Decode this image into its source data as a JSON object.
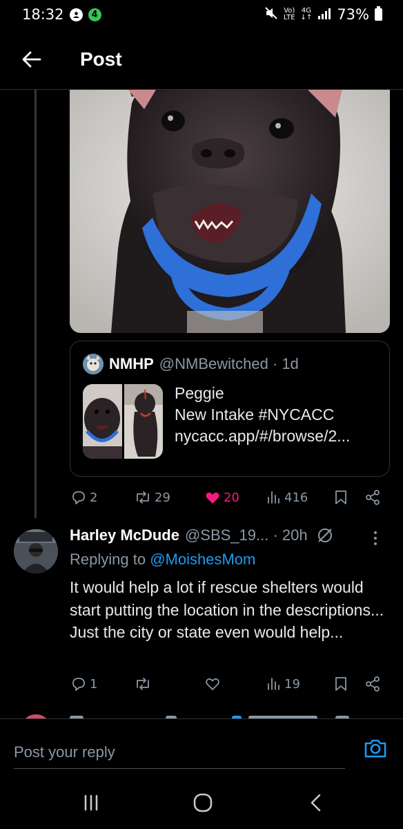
{
  "status_bar": {
    "time": "18:32",
    "notification_badge": "4",
    "network_top": "Vo)",
    "network_bottom": "LTE",
    "gen_top": "4G",
    "gen_bottom": "↓↑",
    "battery": "73%"
  },
  "header": {
    "title": "Post"
  },
  "quote": {
    "name": "NMHP",
    "handle_time": "@NMBewitched · 1d",
    "text_lines": [
      "Peggie",
      "New Intake #NYCACC",
      "nycacc.app/#/browse/2..."
    ]
  },
  "main_actions": {
    "replies": "2",
    "reposts": "29",
    "likes": "20",
    "views": "416"
  },
  "reply": {
    "name": "Harley McDude",
    "handle_time": "@SBS_19... · 20h",
    "replying_prefix": "Replying to ",
    "replying_to": "@MoishesMom",
    "text": "It would help a lot if rescue shelters would start putting the location in the descriptions... Just the city or state even would help...",
    "actions": {
      "replies": "1",
      "reposts": "",
      "likes": "",
      "views": "19"
    }
  },
  "composer": {
    "placeholder": "Post your reply"
  },
  "colors": {
    "accent": "#1d9bf0",
    "like": "#f91880",
    "muted": "#8b98a5",
    "background": "#000000"
  },
  "icons": [
    "back-arrow-icon",
    "reply-icon",
    "repost-icon",
    "heart-icon",
    "views-icon",
    "bookmark-icon",
    "share-icon",
    "grok-icon",
    "camera-icon",
    "recents-icon",
    "home-icon",
    "back-nav-icon"
  ]
}
